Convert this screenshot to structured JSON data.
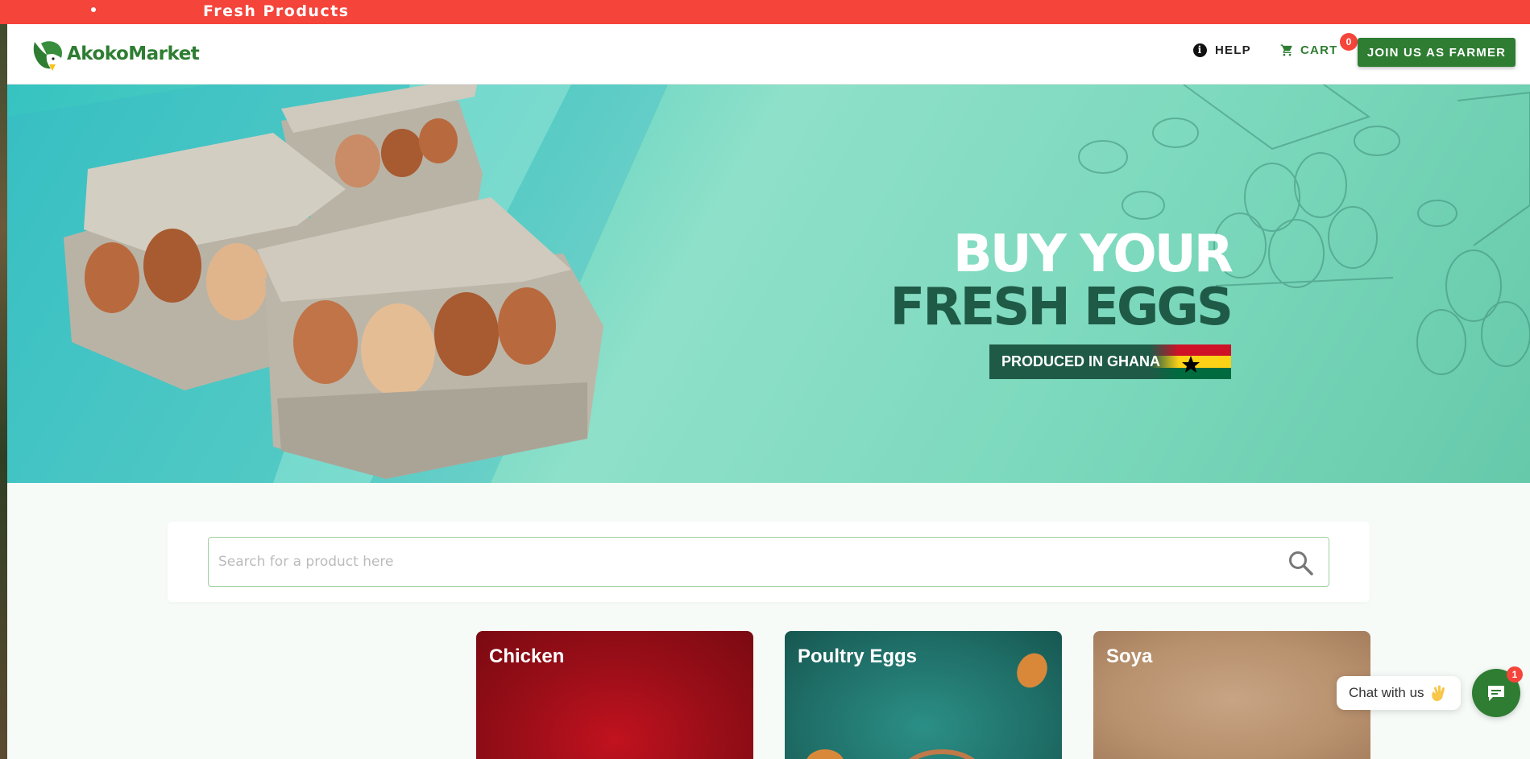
{
  "ticker": {
    "text": "Fresh Products"
  },
  "header": {
    "logo_text": "AkokoMarket",
    "help_label": "HELP",
    "cart_label": "CART",
    "cart_count": "0",
    "join_label": "JOIN US AS FARMER"
  },
  "hero": {
    "title_line1": "BUY YOUR",
    "title_line2": "FRESH EGGS",
    "badge": "PRODUCED IN GHANA"
  },
  "search": {
    "placeholder": "Search for a product here",
    "value": ""
  },
  "categories": [
    {
      "label": "Chicken"
    },
    {
      "label": "Poultry Eggs"
    },
    {
      "label": "Soya"
    }
  ],
  "chat": {
    "bubble_text": "Chat with us",
    "badge": "1"
  },
  "colors": {
    "brand_green": "#2e7d32",
    "ticker_red": "#f5443a",
    "hero_dark": "#1f5a47"
  }
}
